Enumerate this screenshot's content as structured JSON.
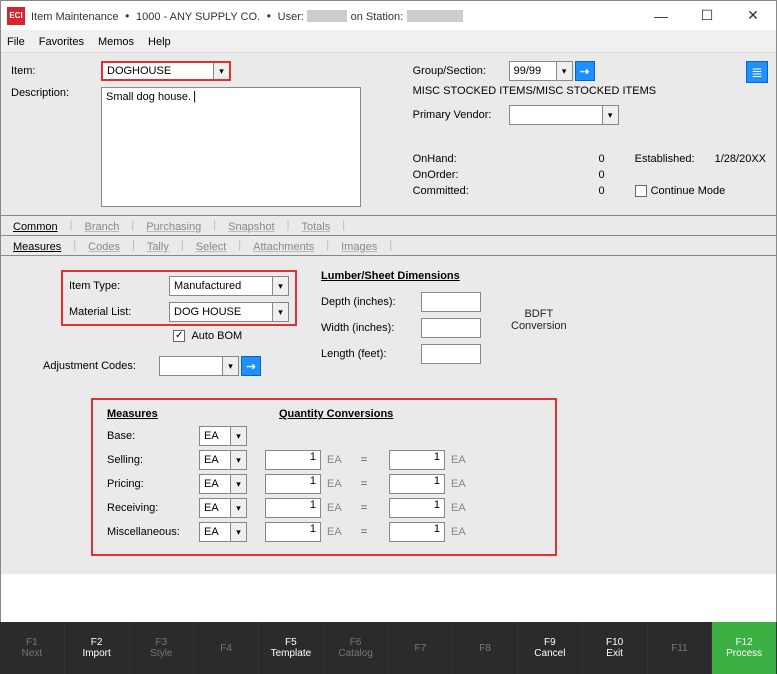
{
  "title": {
    "app": "Item Maintenance",
    "company": "1000 - ANY SUPPLY CO.",
    "userPrefix": "User:",
    "stationPrefix": "on Station:"
  },
  "menu": [
    "File",
    "Favorites",
    "Memos",
    "Help"
  ],
  "top": {
    "itemLbl": "Item:",
    "item": "DOGHOUSE",
    "descLbl": "Description:",
    "desc": "Small dog house.",
    "groupLbl": "Group/Section:",
    "group": "99/99",
    "sectionText": "MISC STOCKED ITEMS/MISC STOCKED ITEMS",
    "vendorLbl": "Primary Vendor:",
    "vendor": "",
    "onhandLbl": "OnHand:",
    "onhand": "0",
    "onorderLbl": "OnOrder:",
    "onorder": "0",
    "committedLbl": "Committed:",
    "committed": "0",
    "establishedLbl": "Established:",
    "established": "1/28/20",
    "continueLbl": "Continue Mode"
  },
  "tabs1": [
    "Common",
    "Branch",
    "Purchasing",
    "Snapshot",
    "Totals"
  ],
  "tabs2": [
    "Measures",
    "Codes",
    "Tally",
    "Select",
    "Attachments",
    "Images"
  ],
  "form": {
    "itemTypeLbl": "Item Type:",
    "itemType": "Manufactured",
    "matListLbl": "Material List:",
    "matList": "DOG HOUSE",
    "autoBomLbl": "Auto BOM",
    "adjLbl": "Adjustment Codes:",
    "lumberTitle": "Lumber/Sheet Dimensions",
    "depthLbl": "Depth (inches):",
    "widthLbl": "Width   (inches):",
    "lengthLbl": "Length (feet):",
    "bdft1": "BDFT",
    "bdft2": "Conversion",
    "measuresHdr": "Measures",
    "qtyHdr": "Quantity Conversions",
    "baseLbl": "Base:",
    "sellLbl": "Selling:",
    "priceLbl": "Pricing:",
    "recvLbl": "Receiving:",
    "miscLbl": "Miscellaneous:",
    "ea": "EA",
    "one": "1",
    "eq": "="
  },
  "fkeys": [
    {
      "n": "F1",
      "t": "Next",
      "a": false
    },
    {
      "n": "F2",
      "t": "Import",
      "a": true
    },
    {
      "n": "F3",
      "t": "Style",
      "a": false
    },
    {
      "n": "F4",
      "t": "",
      "a": false
    },
    {
      "n": "F5",
      "t": "Template",
      "a": true
    },
    {
      "n": "F6",
      "t": "Catalog",
      "a": false
    },
    {
      "n": "F7",
      "t": "",
      "a": false
    },
    {
      "n": "F8",
      "t": "",
      "a": false
    },
    {
      "n": "F9",
      "t": "Cancel",
      "a": true
    },
    {
      "n": "F10",
      "t": "Exit",
      "a": true
    },
    {
      "n": "F11",
      "t": "",
      "a": false
    },
    {
      "n": "F12",
      "t": "Process",
      "a": true,
      "g": true
    }
  ]
}
